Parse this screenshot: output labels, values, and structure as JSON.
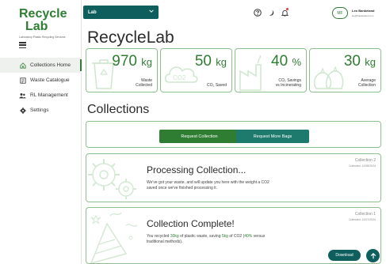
{
  "logo": {
    "line1": "Recycle",
    "line2": "Lab",
    "tagline": "Laboratory Plastic Recycling Services"
  },
  "sidebar": {
    "items": [
      {
        "label": "Collections Home",
        "icon": "home-icon",
        "active": true
      },
      {
        "label": "Waste Catalogue",
        "icon": "catalogue-icon",
        "active": false
      },
      {
        "label": "RL Management",
        "icon": "people-icon",
        "active": false
      },
      {
        "label": "Settings",
        "icon": "gear-icon",
        "active": false
      }
    ]
  },
  "header": {
    "lab_select": "Lab",
    "user_initials": "MF",
    "user_name": "Leo Bankeland",
    "user_email": "leo@bankeland.com"
  },
  "main": {
    "title": "RecycleLab",
    "stats": [
      {
        "value": "970",
        "unit": "kg",
        "label_line1": "Waste",
        "label_line2": "Collected"
      },
      {
        "value": "50",
        "unit": "kg",
        "label_line1": "CO₂ Saved",
        "label_line2": ""
      },
      {
        "value": "40",
        "unit": "%",
        "label_line1": "CO₂ Savings",
        "label_line2": "vs Incinerating"
      },
      {
        "value": "30",
        "unit": "kg",
        "label_line1": "Average",
        "label_line2": "Collection"
      }
    ],
    "collections_title": "Collections",
    "actions": {
      "request_collection": "Request Collection",
      "request_bags": "Request More Bags"
    },
    "collections": [
      {
        "id_label": "Collection 2",
        "date": "Collected: 12/08/2024",
        "title": "Processing Collection...",
        "text1": "We've got your waste, and will update you here with the weight a CO2",
        "text2": "saved once we've finished processing it."
      },
      {
        "id_label": "Collection 1",
        "date": "Collected: 12/07/2024",
        "title": "Collection Complete!",
        "t_a": "You recycled ",
        "t_b": "30kg",
        "t_c": " of plastic waste, saving ",
        "t_d": "5kg",
        "t_e": " of CO2 (",
        "t_f": "40%",
        "t_g": " versus",
        "text2": "traditional methods)."
      }
    ]
  },
  "footer": {
    "download_label": "Download"
  },
  "colors": {
    "brand_green": "#2e7d32",
    "teal": "#0e5e5e",
    "card_border": "#8fbf8f"
  }
}
